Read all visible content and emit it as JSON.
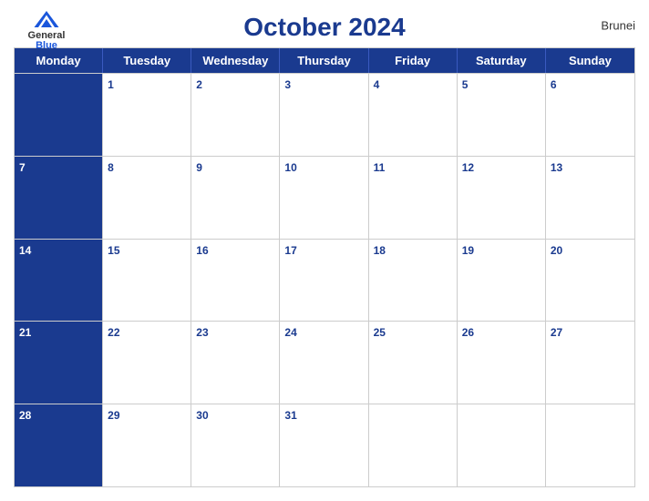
{
  "header": {
    "logo": {
      "general": "General",
      "blue": "Blue"
    },
    "title": "October 2024",
    "country": "Brunei"
  },
  "days": {
    "headers": [
      "Monday",
      "Tuesday",
      "Wednesday",
      "Thursday",
      "Friday",
      "Saturday",
      "Sunday"
    ]
  },
  "weeks": [
    [
      {
        "num": "",
        "blue": true
      },
      {
        "num": "1",
        "blue": false
      },
      {
        "num": "2",
        "blue": false
      },
      {
        "num": "3",
        "blue": false
      },
      {
        "num": "4",
        "blue": false
      },
      {
        "num": "5",
        "blue": false
      },
      {
        "num": "6",
        "blue": false
      }
    ],
    [
      {
        "num": "7",
        "blue": true
      },
      {
        "num": "8",
        "blue": false
      },
      {
        "num": "9",
        "blue": false
      },
      {
        "num": "10",
        "blue": false
      },
      {
        "num": "11",
        "blue": false
      },
      {
        "num": "12",
        "blue": false
      },
      {
        "num": "13",
        "blue": false
      }
    ],
    [
      {
        "num": "14",
        "blue": true
      },
      {
        "num": "15",
        "blue": false
      },
      {
        "num": "16",
        "blue": false
      },
      {
        "num": "17",
        "blue": false
      },
      {
        "num": "18",
        "blue": false
      },
      {
        "num": "19",
        "blue": false
      },
      {
        "num": "20",
        "blue": false
      }
    ],
    [
      {
        "num": "21",
        "blue": true
      },
      {
        "num": "22",
        "blue": false
      },
      {
        "num": "23",
        "blue": false
      },
      {
        "num": "24",
        "blue": false
      },
      {
        "num": "25",
        "blue": false
      },
      {
        "num": "26",
        "blue": false
      },
      {
        "num": "27",
        "blue": false
      }
    ],
    [
      {
        "num": "28",
        "blue": true
      },
      {
        "num": "29",
        "blue": false
      },
      {
        "num": "30",
        "blue": false
      },
      {
        "num": "31",
        "blue": false
      },
      {
        "num": "",
        "blue": false
      },
      {
        "num": "",
        "blue": false
      },
      {
        "num": "",
        "blue": false
      }
    ]
  ]
}
